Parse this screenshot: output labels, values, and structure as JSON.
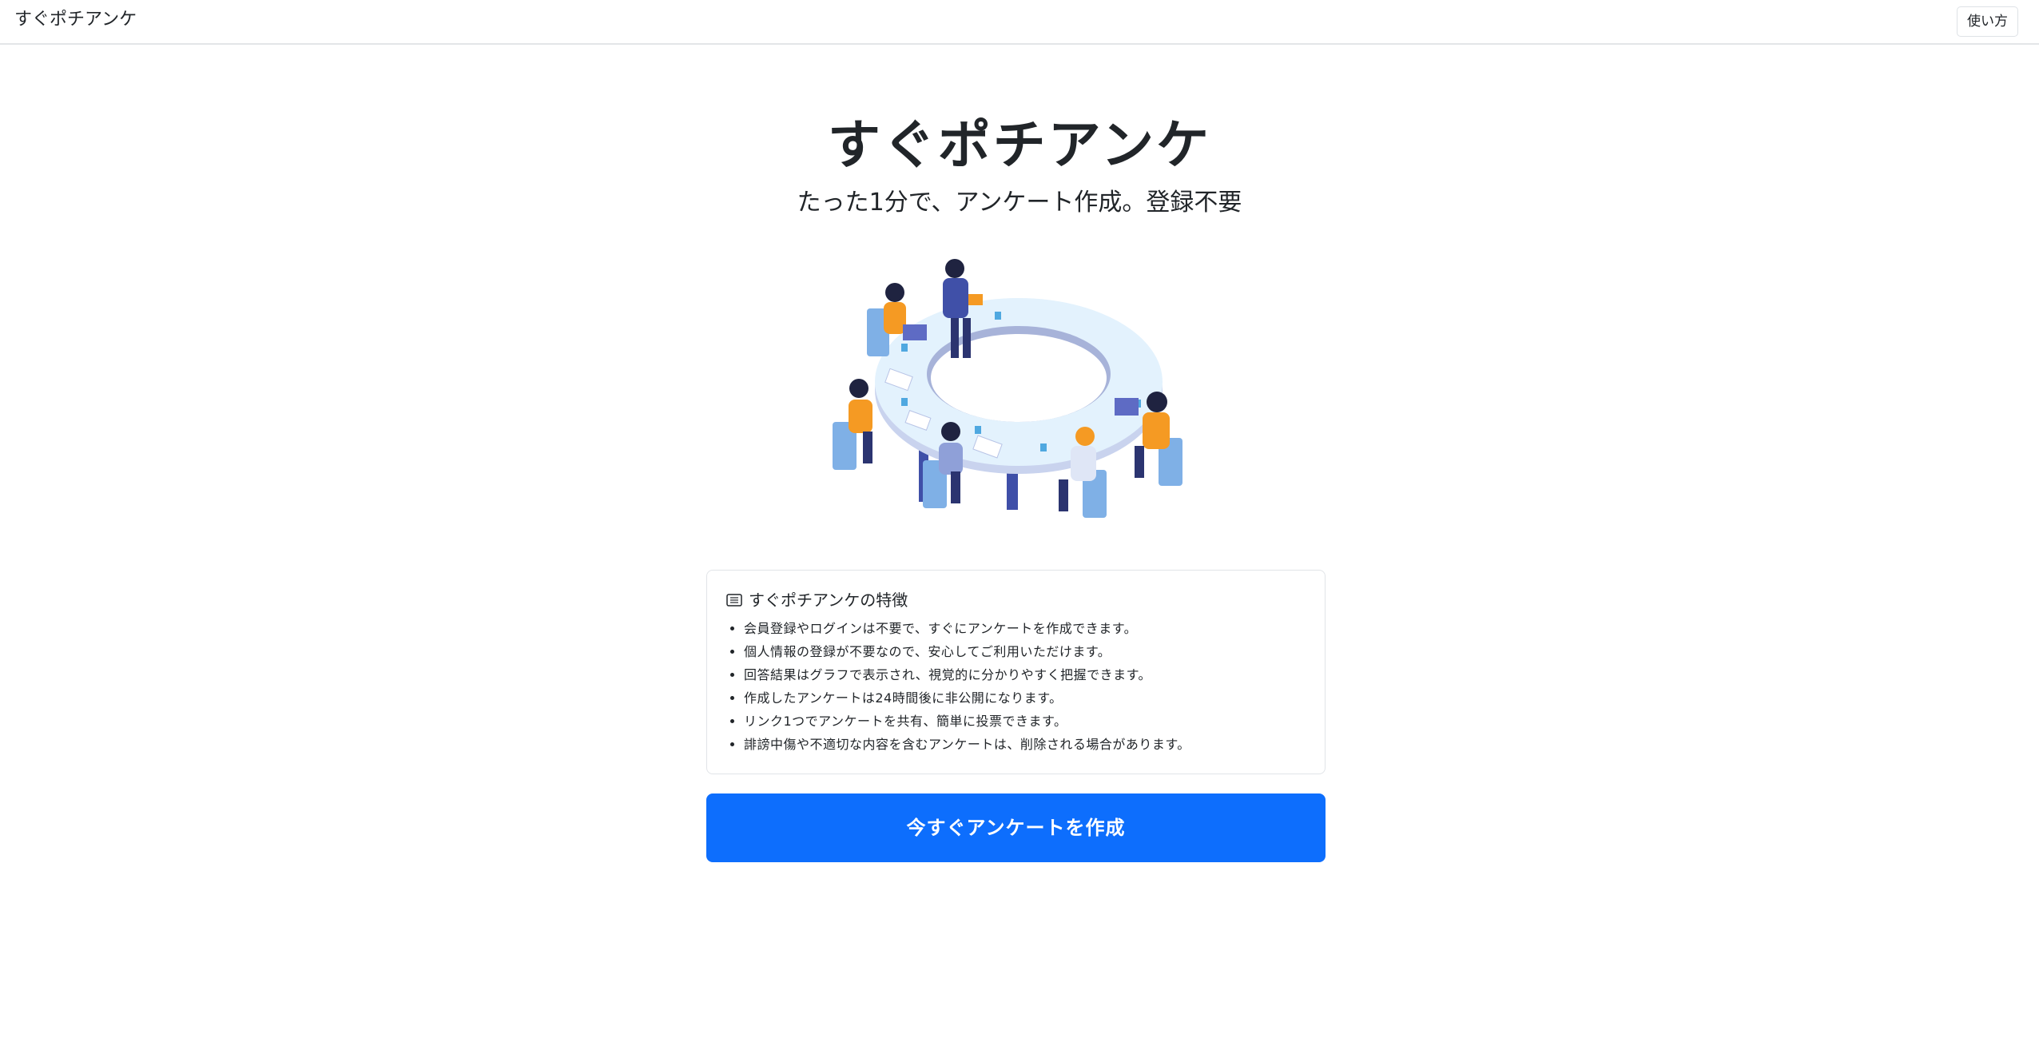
{
  "navbar": {
    "brand": "すぐポチアンケ",
    "help_label": "使い方"
  },
  "hero": {
    "title": "すぐポチアンケ",
    "subtitle": "たった1分で、アンケート作成。登録不要"
  },
  "illustration": {
    "icon": "team-meeting-illustration"
  },
  "features": {
    "heading": "すぐポチアンケの特徴",
    "heading_icon": "list-card-icon",
    "items": [
      "会員登録やログインは不要で、すぐにアンケートを作成できます。",
      "個人情報の登録が不要なので、安心してご利用いただけます。",
      "回答結果はグラフで表示され、視覚的に分かりやすく把握できます。",
      "作成したアンケートは24時間後に非公開になります。",
      "リンク1つでアンケートを共有、簡単に投票できます。",
      "誹謗中傷や不適切な内容を含むアンケートは、削除される場合があります。"
    ]
  },
  "cta": {
    "label": "今すぐアンケートを作成"
  },
  "colors": {
    "primary": "#0d6efd",
    "text": "#212529",
    "border": "#dee2e6"
  }
}
